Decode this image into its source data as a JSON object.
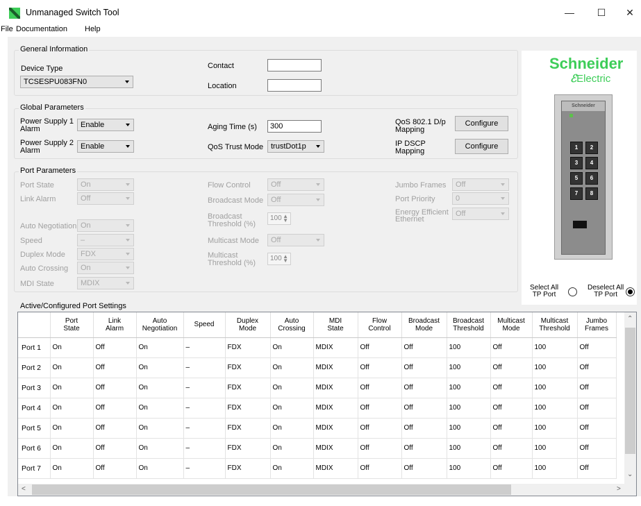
{
  "window": {
    "title": "Unmanaged Switch Tool",
    "minimize": "—",
    "maximize": "☐",
    "close": "✕"
  },
  "menu": [
    "File",
    "Documentation",
    "Help"
  ],
  "general": {
    "title": "General Information",
    "device_type_label": "Device Type",
    "device_type_value": "TCSESPU083FN0",
    "contact_label": "Contact",
    "contact_value": "",
    "location_label": "Location",
    "location_value": ""
  },
  "global": {
    "title": "Global Parameters",
    "ps1_label_a": "Power Supply 1",
    "ps1_label_b": "Alarm",
    "ps1_value": "Enable",
    "ps2_label_a": "Power Supply 2",
    "ps2_label_b": "Alarm",
    "ps2_value": "Enable",
    "aging_label": "Aging Time (s)",
    "aging_value": "300",
    "qos_trust_label": "QoS Trust Mode",
    "qos_trust_value": "trustDot1p",
    "qos_8021_label_a": "QoS 802.1 D/p",
    "qos_8021_label_b": "Mapping",
    "ip_dscp_label_a": "IP DSCP",
    "ip_dscp_label_b": "Mapping",
    "configure_label": "Configure"
  },
  "port_params": {
    "title": "Port Parameters",
    "port_state_label": "Port State",
    "port_state_value": "On",
    "link_alarm_label": "Link Alarm",
    "link_alarm_value": "Off",
    "auto_neg_label": "Auto Negotiation",
    "auto_neg_value": "On",
    "speed_label": "Speed",
    "speed_value": "–",
    "duplex_label": "Duplex Mode",
    "duplex_value": "FDX",
    "auto_cross_label": "Auto Crossing",
    "auto_cross_value": "On",
    "mdi_label": "MDI State",
    "mdi_value": "MDIX",
    "flow_label": "Flow Control",
    "flow_value": "Off",
    "bcast_mode_label": "Broadcast Mode",
    "bcast_mode_value": "Off",
    "bcast_thr_label_a": "Broadcast",
    "bcast_thr_label_b": "Threshold (%)",
    "bcast_thr_value": "100",
    "mcast_mode_label": "Multicast Mode",
    "mcast_mode_value": "Off",
    "mcast_thr_label_a": "Multicast",
    "mcast_thr_label_b": "Threshold (%)",
    "mcast_thr_value": "100",
    "jumbo_label": "Jumbo Frames",
    "jumbo_value": "Off",
    "priority_label": "Port Priority",
    "priority_value": "0",
    "eee_label_a": "Energy Efficient",
    "eee_label_b": "Ethernet",
    "eee_value": "Off"
  },
  "brand": {
    "wordmark": "Schneider",
    "sub": "Electric",
    "device_badge": "Schneider",
    "ports": [
      "1",
      "2",
      "3",
      "4",
      "5",
      "6",
      "7",
      "8"
    ]
  },
  "tp_select": {
    "select_all_a": "Select All",
    "select_all_b": "TP Port",
    "deselect_all_a": "Deselect All",
    "deselect_all_b": "TP Port",
    "selected": "deselect"
  },
  "active": {
    "title": "Active/Configured Port Settings",
    "columns": [
      [
        "",
        ""
      ],
      [
        "Port",
        "State"
      ],
      [
        "Link",
        "Alarm"
      ],
      [
        "Auto",
        "Negotiation"
      ],
      [
        "Speed",
        ""
      ],
      [
        "Duplex",
        "Mode"
      ],
      [
        "Auto",
        "Crossing"
      ],
      [
        "MDI",
        "State"
      ],
      [
        "Flow",
        "Control"
      ],
      [
        "Broadcast",
        "Mode"
      ],
      [
        "Broadcast",
        "Threshold"
      ],
      [
        "Multicast",
        "Mode"
      ],
      [
        "Multicast",
        "Threshold"
      ],
      [
        "Jumbo",
        "Frames"
      ]
    ],
    "rows": [
      [
        "Port 1",
        "On",
        "Off",
        "On",
        "–",
        "FDX",
        "On",
        "MDIX",
        "Off",
        "Off",
        "100",
        "Off",
        "100",
        "Off"
      ],
      [
        "Port 2",
        "On",
        "Off",
        "On",
        "–",
        "FDX",
        "On",
        "MDIX",
        "Off",
        "Off",
        "100",
        "Off",
        "100",
        "Off"
      ],
      [
        "Port 3",
        "On",
        "Off",
        "On",
        "–",
        "FDX",
        "On",
        "MDIX",
        "Off",
        "Off",
        "100",
        "Off",
        "100",
        "Off"
      ],
      [
        "Port 4",
        "On",
        "Off",
        "On",
        "–",
        "FDX",
        "On",
        "MDIX",
        "Off",
        "Off",
        "100",
        "Off",
        "100",
        "Off"
      ],
      [
        "Port 5",
        "On",
        "Off",
        "On",
        "–",
        "FDX",
        "On",
        "MDIX",
        "Off",
        "Off",
        "100",
        "Off",
        "100",
        "Off"
      ],
      [
        "Port 6",
        "On",
        "Off",
        "On",
        "–",
        "FDX",
        "On",
        "MDIX",
        "Off",
        "Off",
        "100",
        "Off",
        "100",
        "Off"
      ],
      [
        "Port 7",
        "On",
        "Off",
        "On",
        "–",
        "FDX",
        "On",
        "MDIX",
        "Off",
        "Off",
        "100",
        "Off",
        "100",
        "Off"
      ]
    ]
  },
  "colors": {
    "brand_green": "#3dcd58",
    "panel_bg": "#f0f0f0"
  }
}
